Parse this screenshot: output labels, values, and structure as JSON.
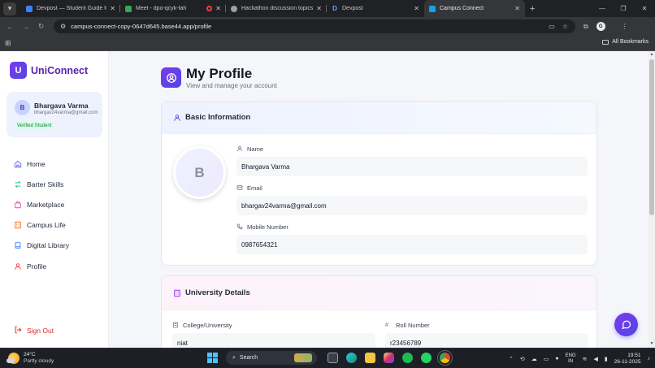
{
  "browser": {
    "tabs": [
      {
        "title": "Devpost — Student Guide for F",
        "favicon_color": "#3b82f6",
        "active": false
      },
      {
        "title": "Meet - dpo-qcyk-fah",
        "favicon_color": "#34a853",
        "active": false
      },
      {
        "title": "",
        "favicon_color": "#ea4335",
        "active": false
      },
      {
        "title": "Hackathon discussion topics",
        "favicon_color": "#9aa0a6",
        "active": false
      },
      {
        "title": "Devpost",
        "favicon_color": "#1e40af",
        "active": false
      },
      {
        "title": "Campus Connect",
        "favicon_color": "#0ea5e9",
        "active": true
      }
    ],
    "url": "campus-connect-copy-0647d645.base44.app/profile",
    "bookmarks_label": "All Bookmarks"
  },
  "app": {
    "brand_letter": "U",
    "brand_name": "UniConnect",
    "brand_color": "#7c3aed"
  },
  "user": {
    "initial": "B",
    "name": "Bhargava Varma",
    "email": "bhargav24varma@gmail.com",
    "badge": "Verified Student"
  },
  "nav": {
    "items": [
      {
        "label": "Home",
        "icon": "home-icon",
        "color": "#6366f1"
      },
      {
        "label": "Barter Skills",
        "icon": "swap-icon",
        "color": "#10b981"
      },
      {
        "label": "Marketplace",
        "icon": "shopping-bag-icon",
        "color": "#ec4899"
      },
      {
        "label": "Campus Life",
        "icon": "building-icon",
        "color": "#f97316"
      },
      {
        "label": "Digital Library",
        "icon": "book-icon",
        "color": "#3b82f6"
      },
      {
        "label": "Profile",
        "icon": "user-icon",
        "color": "#ef4444"
      }
    ],
    "signout": "Sign Out"
  },
  "page": {
    "title": "My Profile",
    "subtitle": "View and manage your account"
  },
  "basic": {
    "heading": "Basic Information",
    "avatar_initial": "B",
    "name_label": "Name",
    "name_value": "Bhargava Varma",
    "email_label": "Email",
    "email_value": "bhargav24varma@gmail.com",
    "mobile_label": "Mobile Number",
    "mobile_value": "0987654321"
  },
  "university": {
    "heading": "University Details",
    "college_label": "College/University",
    "college_value": "niat",
    "roll_label": "Roll Number",
    "roll_value": "r23456789"
  },
  "taskbar": {
    "temp": "24°C",
    "weather": "Partly cloudy",
    "search": "Search",
    "lang_top": "ENG",
    "lang_bottom": "IN",
    "time": "19:51",
    "date": "26-11-2025"
  }
}
